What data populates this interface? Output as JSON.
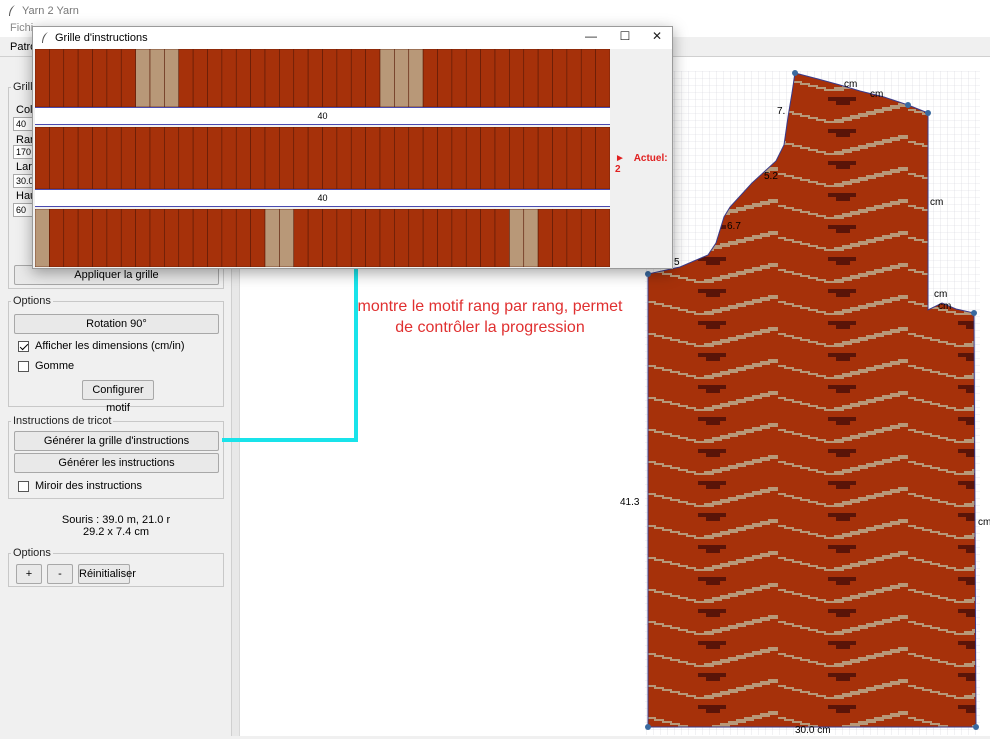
{
  "app": {
    "title": "Yarn 2 Yarn",
    "menu_fichier": "Fichi",
    "tab_patron": "Patro"
  },
  "grille_group": {
    "legend": "Grill",
    "labels": [
      "Col",
      "Ran",
      "Larg",
      "Hau"
    ],
    "values": [
      "40",
      "170",
      "30.0",
      "60"
    ],
    "apply_button": "Appliquer la grille"
  },
  "options_group": {
    "legend": "Options",
    "rotation_button": "Rotation 90°",
    "show_dims_label": "Afficher les dimensions (cm/in)",
    "show_dims_checked": true,
    "eraser_label": "Gomme",
    "eraser_checked": false,
    "config_motif_button": "Configurer motif"
  },
  "instructions_group": {
    "legend": "Instructions de tricot",
    "gen_grid_button": "Générer la grille d'instructions",
    "gen_instr_button": "Générer les instructions",
    "mirror_label": "Miroir des instructions",
    "mirror_checked": false
  },
  "mouse": {
    "line1": "Souris : 39.0 m, 21.0 r",
    "line2": "29.2 x 7.4 cm"
  },
  "zoom_group": {
    "legend": "Options",
    "plus": "+",
    "minus": "-",
    "reset": "Réinitialiser"
  },
  "dialog": {
    "title": "Grille d'instructions",
    "minimize": "—",
    "maximize": "☐",
    "close": "✕",
    "separator1": "40",
    "separator2": "40",
    "current_marker": "►",
    "current_label": "Actuel: 2"
  },
  "annotation": {
    "text": "montre le motif rang par rang, permet de contrôler la progression"
  },
  "pattern_labels": {
    "l1": "7.",
    "l2": "5.2",
    "l3": "6.7",
    "l4": "5",
    "l5": "41.3",
    "cm1": "cm",
    "cm2": "cm",
    "cm3": "cm",
    "cm4": "cm",
    "cm5": "cm",
    "cm6": "cm",
    "bottom": "30.0 cm"
  },
  "colors": {
    "rust": "#a6310a",
    "tan": "#b89878",
    "dark": "#5a1408",
    "accent_red": "#e03030",
    "cyan": "#19e3ea"
  }
}
